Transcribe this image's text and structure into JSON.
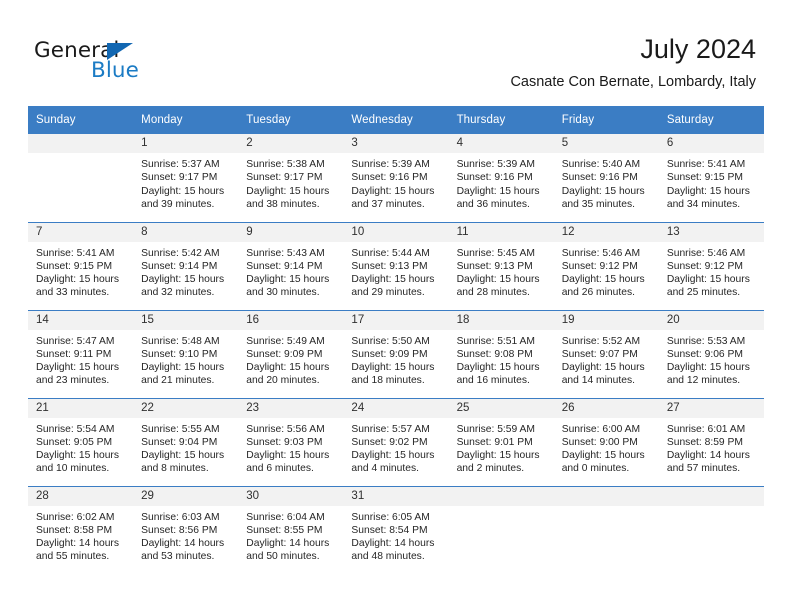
{
  "brand": {
    "name_part1": "General",
    "name_part2": "Blue",
    "logo_icon": "blue-triangle-flag-icon"
  },
  "header": {
    "month_title": "July 2024",
    "location": "Casnate Con Bernate, Lombardy, Italy"
  },
  "colors": {
    "header_blue": "#3b7dc4",
    "brand_blue": "#1b7bc4",
    "daynum_band": "#f2f2f2",
    "text": "#262626"
  },
  "weekday_headers": [
    "Sunday",
    "Monday",
    "Tuesday",
    "Wednesday",
    "Thursday",
    "Friday",
    "Saturday"
  ],
  "weeks": [
    [
      {
        "day": "",
        "sunrise": "",
        "sunset": "",
        "daylight1": "",
        "daylight2": ""
      },
      {
        "day": "1",
        "sunrise": "Sunrise: 5:37 AM",
        "sunset": "Sunset: 9:17 PM",
        "daylight1": "Daylight: 15 hours",
        "daylight2": "and 39 minutes."
      },
      {
        "day": "2",
        "sunrise": "Sunrise: 5:38 AM",
        "sunset": "Sunset: 9:17 PM",
        "daylight1": "Daylight: 15 hours",
        "daylight2": "and 38 minutes."
      },
      {
        "day": "3",
        "sunrise": "Sunrise: 5:39 AM",
        "sunset": "Sunset: 9:16 PM",
        "daylight1": "Daylight: 15 hours",
        "daylight2": "and 37 minutes."
      },
      {
        "day": "4",
        "sunrise": "Sunrise: 5:39 AM",
        "sunset": "Sunset: 9:16 PM",
        "daylight1": "Daylight: 15 hours",
        "daylight2": "and 36 minutes."
      },
      {
        "day": "5",
        "sunrise": "Sunrise: 5:40 AM",
        "sunset": "Sunset: 9:16 PM",
        "daylight1": "Daylight: 15 hours",
        "daylight2": "and 35 minutes."
      },
      {
        "day": "6",
        "sunrise": "Sunrise: 5:41 AM",
        "sunset": "Sunset: 9:15 PM",
        "daylight1": "Daylight: 15 hours",
        "daylight2": "and 34 minutes."
      }
    ],
    [
      {
        "day": "7",
        "sunrise": "Sunrise: 5:41 AM",
        "sunset": "Sunset: 9:15 PM",
        "daylight1": "Daylight: 15 hours",
        "daylight2": "and 33 minutes."
      },
      {
        "day": "8",
        "sunrise": "Sunrise: 5:42 AM",
        "sunset": "Sunset: 9:14 PM",
        "daylight1": "Daylight: 15 hours",
        "daylight2": "and 32 minutes."
      },
      {
        "day": "9",
        "sunrise": "Sunrise: 5:43 AM",
        "sunset": "Sunset: 9:14 PM",
        "daylight1": "Daylight: 15 hours",
        "daylight2": "and 30 minutes."
      },
      {
        "day": "10",
        "sunrise": "Sunrise: 5:44 AM",
        "sunset": "Sunset: 9:13 PM",
        "daylight1": "Daylight: 15 hours",
        "daylight2": "and 29 minutes."
      },
      {
        "day": "11",
        "sunrise": "Sunrise: 5:45 AM",
        "sunset": "Sunset: 9:13 PM",
        "daylight1": "Daylight: 15 hours",
        "daylight2": "and 28 minutes."
      },
      {
        "day": "12",
        "sunrise": "Sunrise: 5:46 AM",
        "sunset": "Sunset: 9:12 PM",
        "daylight1": "Daylight: 15 hours",
        "daylight2": "and 26 minutes."
      },
      {
        "day": "13",
        "sunrise": "Sunrise: 5:46 AM",
        "sunset": "Sunset: 9:12 PM",
        "daylight1": "Daylight: 15 hours",
        "daylight2": "and 25 minutes."
      }
    ],
    [
      {
        "day": "14",
        "sunrise": "Sunrise: 5:47 AM",
        "sunset": "Sunset: 9:11 PM",
        "daylight1": "Daylight: 15 hours",
        "daylight2": "and 23 minutes."
      },
      {
        "day": "15",
        "sunrise": "Sunrise: 5:48 AM",
        "sunset": "Sunset: 9:10 PM",
        "daylight1": "Daylight: 15 hours",
        "daylight2": "and 21 minutes."
      },
      {
        "day": "16",
        "sunrise": "Sunrise: 5:49 AM",
        "sunset": "Sunset: 9:09 PM",
        "daylight1": "Daylight: 15 hours",
        "daylight2": "and 20 minutes."
      },
      {
        "day": "17",
        "sunrise": "Sunrise: 5:50 AM",
        "sunset": "Sunset: 9:09 PM",
        "daylight1": "Daylight: 15 hours",
        "daylight2": "and 18 minutes."
      },
      {
        "day": "18",
        "sunrise": "Sunrise: 5:51 AM",
        "sunset": "Sunset: 9:08 PM",
        "daylight1": "Daylight: 15 hours",
        "daylight2": "and 16 minutes."
      },
      {
        "day": "19",
        "sunrise": "Sunrise: 5:52 AM",
        "sunset": "Sunset: 9:07 PM",
        "daylight1": "Daylight: 15 hours",
        "daylight2": "and 14 minutes."
      },
      {
        "day": "20",
        "sunrise": "Sunrise: 5:53 AM",
        "sunset": "Sunset: 9:06 PM",
        "daylight1": "Daylight: 15 hours",
        "daylight2": "and 12 minutes."
      }
    ],
    [
      {
        "day": "21",
        "sunrise": "Sunrise: 5:54 AM",
        "sunset": "Sunset: 9:05 PM",
        "daylight1": "Daylight: 15 hours",
        "daylight2": "and 10 minutes."
      },
      {
        "day": "22",
        "sunrise": "Sunrise: 5:55 AM",
        "sunset": "Sunset: 9:04 PM",
        "daylight1": "Daylight: 15 hours",
        "daylight2": "and 8 minutes."
      },
      {
        "day": "23",
        "sunrise": "Sunrise: 5:56 AM",
        "sunset": "Sunset: 9:03 PM",
        "daylight1": "Daylight: 15 hours",
        "daylight2": "and 6 minutes."
      },
      {
        "day": "24",
        "sunrise": "Sunrise: 5:57 AM",
        "sunset": "Sunset: 9:02 PM",
        "daylight1": "Daylight: 15 hours",
        "daylight2": "and 4 minutes."
      },
      {
        "day": "25",
        "sunrise": "Sunrise: 5:59 AM",
        "sunset": "Sunset: 9:01 PM",
        "daylight1": "Daylight: 15 hours",
        "daylight2": "and 2 minutes."
      },
      {
        "day": "26",
        "sunrise": "Sunrise: 6:00 AM",
        "sunset": "Sunset: 9:00 PM",
        "daylight1": "Daylight: 15 hours",
        "daylight2": "and 0 minutes."
      },
      {
        "day": "27",
        "sunrise": "Sunrise: 6:01 AM",
        "sunset": "Sunset: 8:59 PM",
        "daylight1": "Daylight: 14 hours",
        "daylight2": "and 57 minutes."
      }
    ],
    [
      {
        "day": "28",
        "sunrise": "Sunrise: 6:02 AM",
        "sunset": "Sunset: 8:58 PM",
        "daylight1": "Daylight: 14 hours",
        "daylight2": "and 55 minutes."
      },
      {
        "day": "29",
        "sunrise": "Sunrise: 6:03 AM",
        "sunset": "Sunset: 8:56 PM",
        "daylight1": "Daylight: 14 hours",
        "daylight2": "and 53 minutes."
      },
      {
        "day": "30",
        "sunrise": "Sunrise: 6:04 AM",
        "sunset": "Sunset: 8:55 PM",
        "daylight1": "Daylight: 14 hours",
        "daylight2": "and 50 minutes."
      },
      {
        "day": "31",
        "sunrise": "Sunrise: 6:05 AM",
        "sunset": "Sunset: 8:54 PM",
        "daylight1": "Daylight: 14 hours",
        "daylight2": "and 48 minutes."
      },
      {
        "day": "",
        "sunrise": "",
        "sunset": "",
        "daylight1": "",
        "daylight2": ""
      },
      {
        "day": "",
        "sunrise": "",
        "sunset": "",
        "daylight1": "",
        "daylight2": ""
      },
      {
        "day": "",
        "sunrise": "",
        "sunset": "",
        "daylight1": "",
        "daylight2": ""
      }
    ]
  ]
}
